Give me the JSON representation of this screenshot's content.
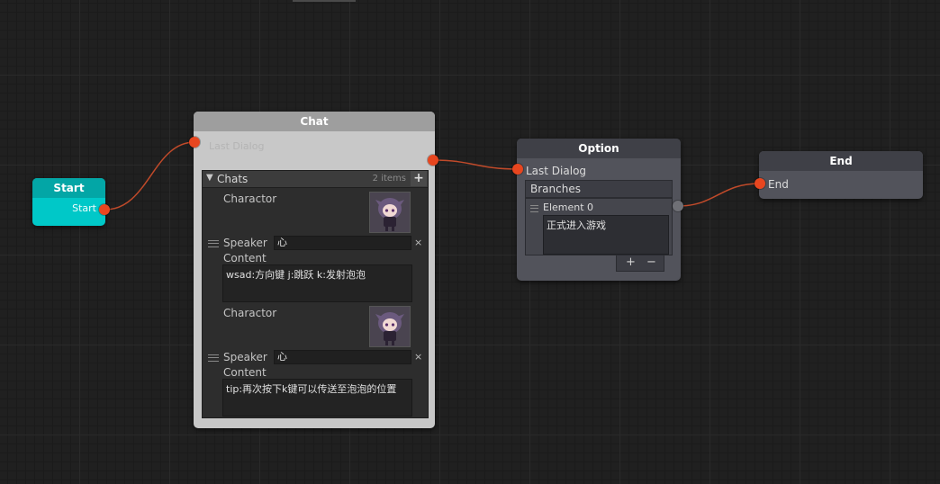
{
  "nodes": {
    "start": {
      "title": "Start",
      "port_label": "Start"
    },
    "chat": {
      "title": "Chat",
      "input_label": "Last Dialog",
      "list_title": "Chats",
      "list_count": "2 items",
      "add_symbol": "+",
      "entries": [
        {
          "charactor_label": "Charactor",
          "speaker_label": "Speaker",
          "speaker_value": "心",
          "content_label": "Content",
          "content_value": "wsad:方向键 j:跳跃 k:发射泡泡",
          "remove_symbol": "×"
        },
        {
          "charactor_label": "Charactor",
          "speaker_label": "Speaker",
          "speaker_value": "心",
          "content_label": "Content",
          "content_value": "tip:再次按下k键可以传送至泡泡的位置",
          "remove_symbol": "×"
        }
      ]
    },
    "option": {
      "title": "Option",
      "input_label": "Last Dialog",
      "branches_label": "Branches",
      "element_label": "Element 0",
      "element_value": "正式进入游戏",
      "plus_symbol": "+",
      "minus_symbol": "−"
    },
    "end": {
      "title": "End",
      "port_label": "End"
    }
  },
  "colors": {
    "background": "#202020",
    "port_active": "#e8461f",
    "port_idle": "#6f7076",
    "wire": "#c04a2a",
    "start_node": "#00c8c8",
    "chat_node": "#c8c8c8",
    "option_node": "#52535b"
  },
  "icons": [
    "collapse-triangle-icon",
    "add-icon",
    "drag-handle-icon",
    "remove-icon",
    "character-portrait"
  ]
}
